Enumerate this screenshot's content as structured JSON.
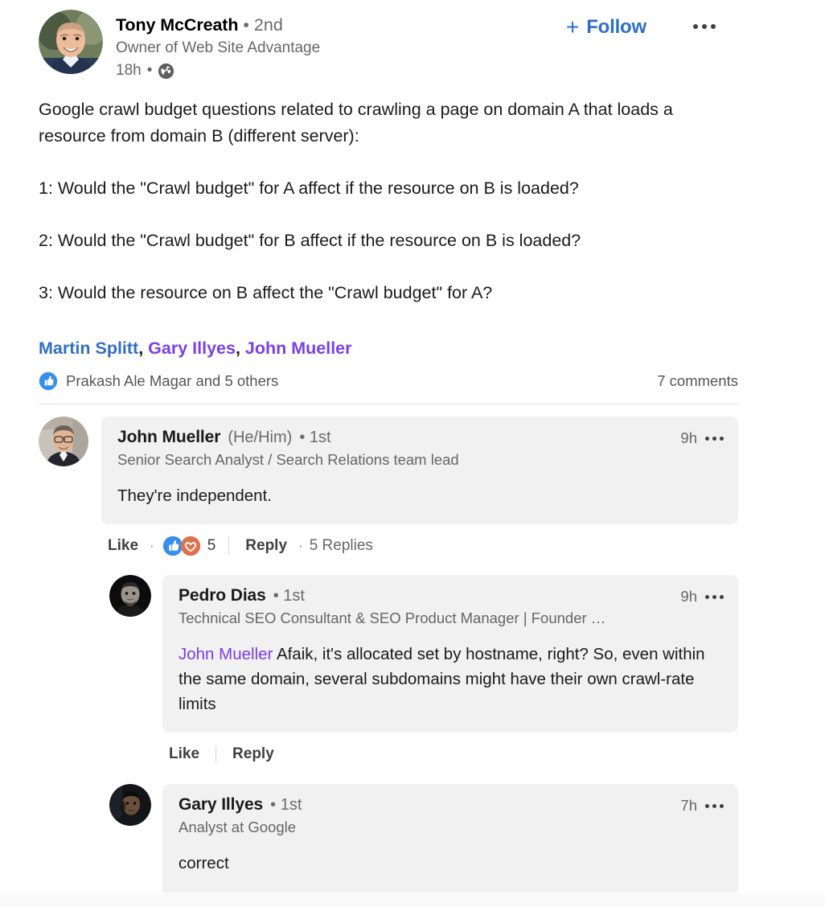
{
  "post": {
    "author": {
      "name": "Tony McCreath",
      "degree_separator": "•",
      "degree": "2nd",
      "headline": "Owner of Web Site Advantage",
      "timestamp": "18h",
      "meta_separator": "•",
      "visibility_icon": "globe-icon"
    },
    "follow": {
      "plus": "+",
      "label": "Follow"
    },
    "overflow_icon": "ellipsis-icon",
    "body": [
      "Google crawl budget questions related to crawling a page on domain A that loads a resource from domain B (different server):",
      "1: Would the \"Crawl budget\" for A affect if the resource on B is loaded?",
      "2: Would the \"Crawl budget\" for B affect if the resource on B is loaded?",
      "3: Would the resource on B affect the \"Crawl budget\" for A?"
    ],
    "mentions": [
      {
        "name": "Martin Splitt",
        "color": "#2f6fc4"
      },
      {
        "name": "Gary Illyes",
        "color": "#7b3fe4"
      },
      {
        "name": "John Mueller",
        "color": "#7b3fe4"
      }
    ],
    "mention_separator": ", ",
    "social": {
      "reaction_icons": [
        "like-thumb-icon"
      ],
      "reactors_text": "Prakash Ale Magar and 5 others",
      "comments_count": "7 comments"
    }
  },
  "comments": [
    {
      "name": "John Mueller",
      "pronoun": "(He/Him)",
      "degree": "• 1st",
      "headline": "Senior Search Analyst / Search Relations team lead",
      "timestamp": "9h",
      "text": "They're independent.",
      "actions": {
        "like": "Like",
        "dot": "·",
        "reaction_count": "5",
        "reply": "Reply",
        "replies_dot": "·",
        "replies": "5 Replies"
      }
    },
    {
      "name": "Pedro Dias",
      "degree": "• 1st",
      "headline": "Technical SEO Consultant & SEO Product Manager | Founder …",
      "timestamp": "9h",
      "mention": "John Mueller",
      "text": " Afaik, it's allocated set by hostname, right? So, even within the same domain, several subdomains might have their own crawl-rate limits",
      "actions": {
        "like": "Like",
        "reply": "Reply"
      }
    },
    {
      "name": "Gary Illyes",
      "degree": "• 1st",
      "headline": "Analyst at Google",
      "timestamp": "7h",
      "text": "correct"
    }
  ],
  "colors": {
    "link_blue": "#2f6fc4",
    "mention_purple": "#7b3fe4",
    "bubble_grey": "#f1f1f1",
    "reaction_blue": "#378fe9",
    "reaction_heart": "#df704d",
    "text_primary": "#1a1a1a",
    "text_secondary": "#666666"
  }
}
